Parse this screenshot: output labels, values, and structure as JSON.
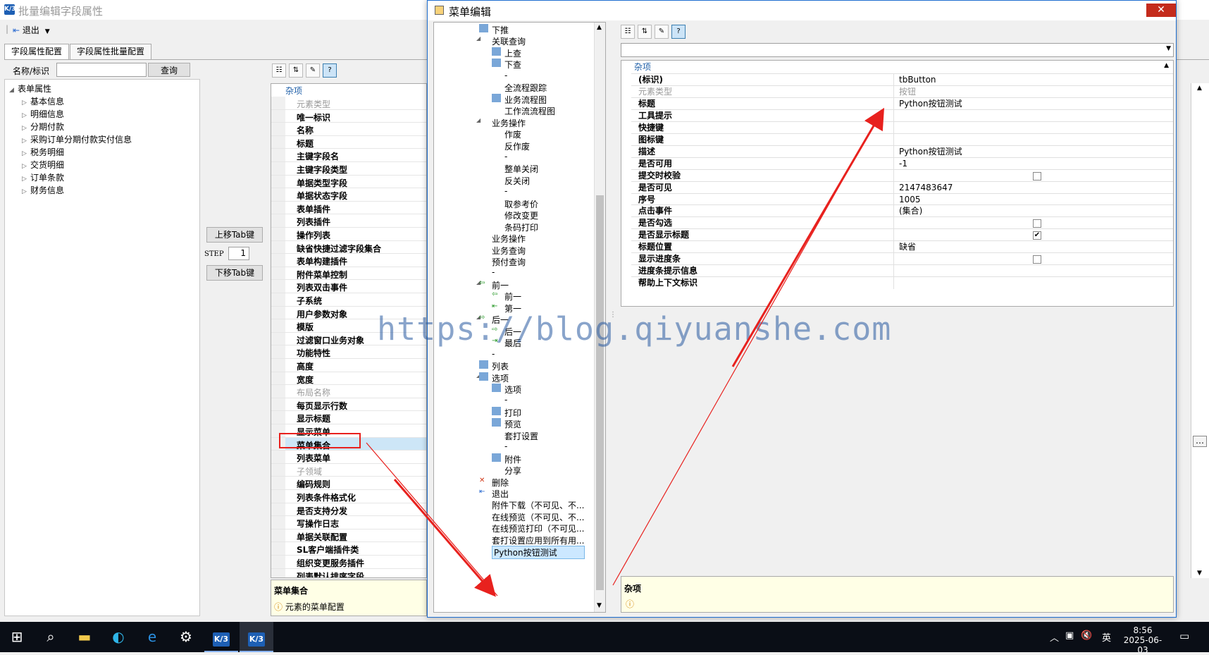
{
  "main": {
    "title": "批量编辑字段属性",
    "logo": "K/3",
    "toolbar": {
      "exit_label": "退出"
    },
    "tabs": [
      "字段属性配置",
      "字段属性批量配置"
    ],
    "search": {
      "label": "名称/标识",
      "button": "查询",
      "value": ""
    },
    "tree": {
      "root": "表单属性",
      "children": [
        "基本信息",
        "明细信息",
        "分期付款",
        "采购订单分期付款实付信息",
        "税务明细",
        "交货明细",
        "订单条款",
        "财务信息"
      ]
    },
    "move_up": "上移Tab键",
    "move_down": "下移Tab键",
    "step_label": "STEP",
    "step_value": "1",
    "grid": {
      "category": "杂项",
      "rows": [
        {
          "label": "元素类型",
          "disabled": true
        },
        {
          "label": "唯一标识"
        },
        {
          "label": "名称"
        },
        {
          "label": "标题"
        },
        {
          "label": "主键字段名"
        },
        {
          "label": "主键字段类型"
        },
        {
          "label": "单据类型字段"
        },
        {
          "label": "单据状态字段"
        },
        {
          "label": "表单插件"
        },
        {
          "label": "列表插件"
        },
        {
          "label": "操作列表"
        },
        {
          "label": "缺省快捷过滤字段集合"
        },
        {
          "label": "表单构建插件"
        },
        {
          "label": "附件菜单控制"
        },
        {
          "label": "列表双击事件"
        },
        {
          "label": "子系统"
        },
        {
          "label": "用户参数对象"
        },
        {
          "label": "模版"
        },
        {
          "label": "过滤窗口业务对象"
        },
        {
          "label": "功能特性"
        },
        {
          "label": "高度"
        },
        {
          "label": "宽度"
        },
        {
          "label": "布局名称",
          "disabled": true
        },
        {
          "label": "每页显示行数"
        },
        {
          "label": "显示标题"
        },
        {
          "label": "显示菜单"
        },
        {
          "label": "菜单集合",
          "selected": true
        },
        {
          "label": "列表菜单"
        },
        {
          "label": "子领域",
          "disabled": true
        },
        {
          "label": "编码规则"
        },
        {
          "label": "列表条件格式化"
        },
        {
          "label": "是否支持分发"
        },
        {
          "label": "写操作日志"
        },
        {
          "label": "单据关联配置"
        },
        {
          "label": "SL客户端插件类"
        },
        {
          "label": "组织变更服务插件"
        },
        {
          "label": "列表默认排序字段"
        }
      ]
    },
    "desc": {
      "title": "菜单集合",
      "text": "元素的菜单配置"
    }
  },
  "dialog": {
    "title": "菜单编辑",
    "close": "✕",
    "tree": [
      {
        "t": "下推",
        "lv": 1,
        "icon": "push-icon"
      },
      {
        "t": "关联查询",
        "lv": 1,
        "exp": true
      },
      {
        "t": "上查",
        "lv": 2,
        "icon": "search-up-icon"
      },
      {
        "t": "下查",
        "lv": 2,
        "icon": "search-down-icon"
      },
      {
        "t": "-",
        "lv": 2
      },
      {
        "t": "全流程跟踪",
        "lv": 2
      },
      {
        "t": "业务流程图",
        "lv": 2,
        "icon": "flowchart-icon"
      },
      {
        "t": "工作流流程图",
        "lv": 2
      },
      {
        "t": "业务操作",
        "lv": 1,
        "exp": true
      },
      {
        "t": "作废",
        "lv": 2
      },
      {
        "t": "反作废",
        "lv": 2
      },
      {
        "t": "-",
        "lv": 2
      },
      {
        "t": "整单关闭",
        "lv": 2
      },
      {
        "t": "反关闭",
        "lv": 2
      },
      {
        "t": "-",
        "lv": 2
      },
      {
        "t": "取参考价",
        "lv": 2
      },
      {
        "t": "修改变更",
        "lv": 2
      },
      {
        "t": "条码打印",
        "lv": 2
      },
      {
        "t": "业务操作",
        "lv": 1
      },
      {
        "t": "业务查询",
        "lv": 1
      },
      {
        "t": "预付查询",
        "lv": 1
      },
      {
        "t": "-",
        "lv": 1
      },
      {
        "t": "前一",
        "lv": 1,
        "exp": true,
        "icon": "arrow-left-icon"
      },
      {
        "t": "前一",
        "lv": 2,
        "icon": "arrow-left-icon"
      },
      {
        "t": "第一",
        "lv": 2,
        "icon": "arrow-first-icon"
      },
      {
        "t": "后一",
        "lv": 1,
        "exp": true,
        "icon": "arrow-right-icon"
      },
      {
        "t": "后一",
        "lv": 2,
        "icon": "arrow-right-icon"
      },
      {
        "t": "最后",
        "lv": 2,
        "icon": "arrow-last-icon"
      },
      {
        "t": "-",
        "lv": 1
      },
      {
        "t": "列表",
        "lv": 1,
        "icon": "list-icon"
      },
      {
        "t": "选项",
        "lv": 1,
        "exp": true,
        "icon": "options-icon"
      },
      {
        "t": "选项",
        "lv": 2,
        "icon": "options-icon"
      },
      {
        "t": "-",
        "lv": 2
      },
      {
        "t": "打印",
        "lv": 2,
        "icon": "print-icon"
      },
      {
        "t": "预览",
        "lv": 2,
        "icon": "preview-icon"
      },
      {
        "t": "套打设置",
        "lv": 2
      },
      {
        "t": "-",
        "lv": 2
      },
      {
        "t": "附件",
        "lv": 2,
        "icon": "attachment-icon"
      },
      {
        "t": "分享",
        "lv": 2
      },
      {
        "t": "删除",
        "lv": 1,
        "icon": "delete-icon"
      },
      {
        "t": "退出",
        "lv": 1,
        "icon": "exit-icon"
      },
      {
        "t": "附件下载（不可见、不...",
        "lv": 1
      },
      {
        "t": "在线预览（不可见、不...",
        "lv": 1
      },
      {
        "t": "在线预览打印（不可见...",
        "lv": 1
      },
      {
        "t": "套打设置应用到所有用...",
        "lv": 1
      },
      {
        "t": "Python按钮测试",
        "lv": 1,
        "selected": true
      }
    ],
    "props": {
      "category": "杂项",
      "combo": "",
      "rows": [
        {
          "k": "(标识)",
          "v": "tbButton"
        },
        {
          "k": "元素类型",
          "v": "按钮",
          "disabled": true
        },
        {
          "k": "标题",
          "v": "Python按钮测试"
        },
        {
          "k": "工具提示",
          "v": ""
        },
        {
          "k": "快捷键",
          "v": ""
        },
        {
          "k": "图标键",
          "v": ""
        },
        {
          "k": "描述",
          "v": "Python按钮测试"
        },
        {
          "k": "是否可用",
          "v": "-1"
        },
        {
          "k": "提交时校验",
          "cb": false
        },
        {
          "k": "是否可见",
          "v": "2147483647"
        },
        {
          "k": "序号",
          "v": "1005"
        },
        {
          "k": "点击事件",
          "v": "(集合)"
        },
        {
          "k": "是否勾选",
          "cb": false
        },
        {
          "k": "是否显示标题",
          "cb": true
        },
        {
          "k": "标题位置",
          "v": "缺省"
        },
        {
          "k": "显示进度条",
          "cb": false
        },
        {
          "k": "进度条提示信息",
          "v": ""
        },
        {
          "k": "帮助上下文标识",
          "v": ""
        }
      ]
    },
    "desc": {
      "title": "杂项"
    }
  },
  "watermark": "https://blog.qiyuanshe.com",
  "taskbar": {
    "time": "8:56",
    "date": "2025-06-03",
    "ime": "英"
  }
}
